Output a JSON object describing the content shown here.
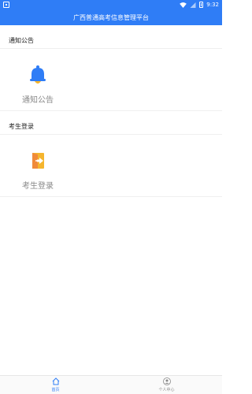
{
  "status": {
    "time": "9:32"
  },
  "header": {
    "title": "广西普通高考信息管理平台"
  },
  "sections": [
    {
      "heading": "通知公告",
      "tile_label": "通知公告",
      "icon": "bell-icon"
    },
    {
      "heading": "考生登录",
      "tile_label": "考生登录",
      "icon": "door-login-icon"
    }
  ],
  "bottom_nav": [
    {
      "label": "首页",
      "icon": "home-icon",
      "active": true
    },
    {
      "label": "个人中心",
      "icon": "user-icon",
      "active": false
    }
  ],
  "colors": {
    "primary": "#2f7df6",
    "bell_yellow": "#f5b52e",
    "door_orange": "#f08a3a"
  }
}
